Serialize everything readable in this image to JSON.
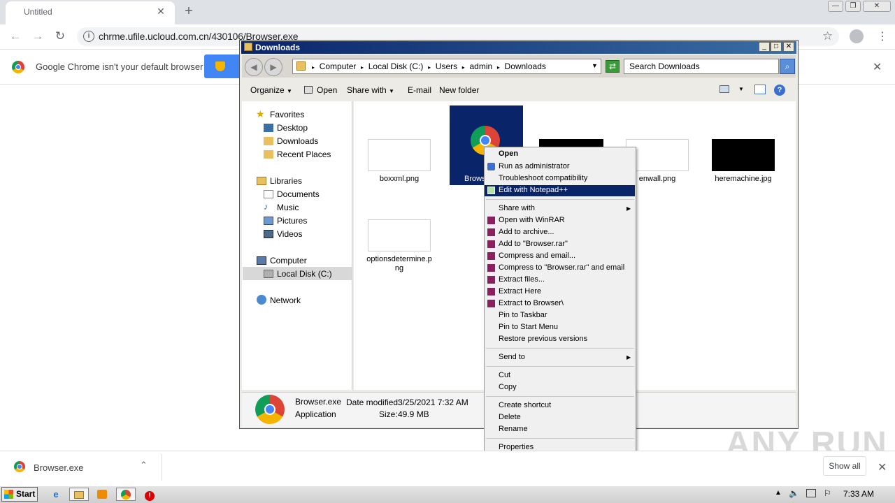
{
  "chrome": {
    "tab_title": "Untitled",
    "tab_close": "✕",
    "new_tab": "+",
    "url": "chrme.ufile.ucloud.com.cn/430106/Browser.exe",
    "infobar_text": "Google Chrome isn't your default browser",
    "infobar_close": "✕",
    "window_buttons": [
      "—",
      "❐",
      "✕"
    ]
  },
  "downloads_bar": {
    "file_name": "Browser.exe",
    "show_all": "Show all",
    "close": "✕"
  },
  "explorer": {
    "title": "Downloads",
    "breadcrumb": [
      "Computer",
      "Local Disk (C:)",
      "Users",
      "admin",
      "Downloads"
    ],
    "search_placeholder": "Search Downloads",
    "commands": [
      "Organize",
      "Open",
      "Share with",
      "E-mail",
      "New folder"
    ],
    "nav": {
      "favorites": "Favorites",
      "favorites_items": [
        "Desktop",
        "Downloads",
        "Recent Places"
      ],
      "libraries": "Libraries",
      "libraries_items": [
        "Documents",
        "Music",
        "Pictures",
        "Videos"
      ],
      "computer": "Computer",
      "computer_items": [
        "Local Disk (C:)"
      ],
      "network": "Network"
    },
    "files": [
      {
        "name": "boxxml.png"
      },
      {
        "name": "Browser.exe"
      },
      {
        "name": "(dark image)"
      },
      {
        "name": "enwall.png"
      },
      {
        "name": "heremachine.jpg"
      },
      {
        "name": "optionsdetermine.png"
      }
    ],
    "visible_labels": {
      "boxxml": "boxxml.png",
      "browser": "Brows",
      "enwall": "enwall.png",
      "heremachine": "heremachine.jpg",
      "options1": "optionsdetermine.p",
      "options2": "ng"
    },
    "details": {
      "name": "Browser.exe",
      "type": "Application",
      "modified_label": "Date modified:",
      "modified_value": "3/25/2021 7:32 AM",
      "size_label": "Size:",
      "size_value": "49.9 MB"
    }
  },
  "context_menu": {
    "items": [
      {
        "label": "Open"
      },
      {
        "label": "Run as administrator"
      },
      {
        "label": "Troubleshoot compatibility"
      },
      {
        "label": "Edit with Notepad++"
      },
      {
        "label": "Share with"
      },
      {
        "label": "Open with WinRAR"
      },
      {
        "label": "Add to archive..."
      },
      {
        "label": "Add to \"Browser.rar\""
      },
      {
        "label": "Compress and email..."
      },
      {
        "label": "Compress to \"Browser.rar\" and email"
      },
      {
        "label": "Extract files..."
      },
      {
        "label": "Extract Here"
      },
      {
        "label": "Extract to Browser\\"
      },
      {
        "label": "Pin to Taskbar"
      },
      {
        "label": "Pin to Start Menu"
      },
      {
        "label": "Restore previous versions"
      },
      {
        "label": "Send to"
      },
      {
        "label": "Cut"
      },
      {
        "label": "Copy"
      },
      {
        "label": "Create shortcut"
      },
      {
        "label": "Delete"
      },
      {
        "label": "Rename"
      },
      {
        "label": "Properties"
      }
    ]
  },
  "taskbar": {
    "start": "Start",
    "clock": "7:33 AM"
  },
  "watermark": "ANY RUN",
  "colors": {
    "selection": "#0a246a",
    "chrome_blue": "#4285f4"
  }
}
